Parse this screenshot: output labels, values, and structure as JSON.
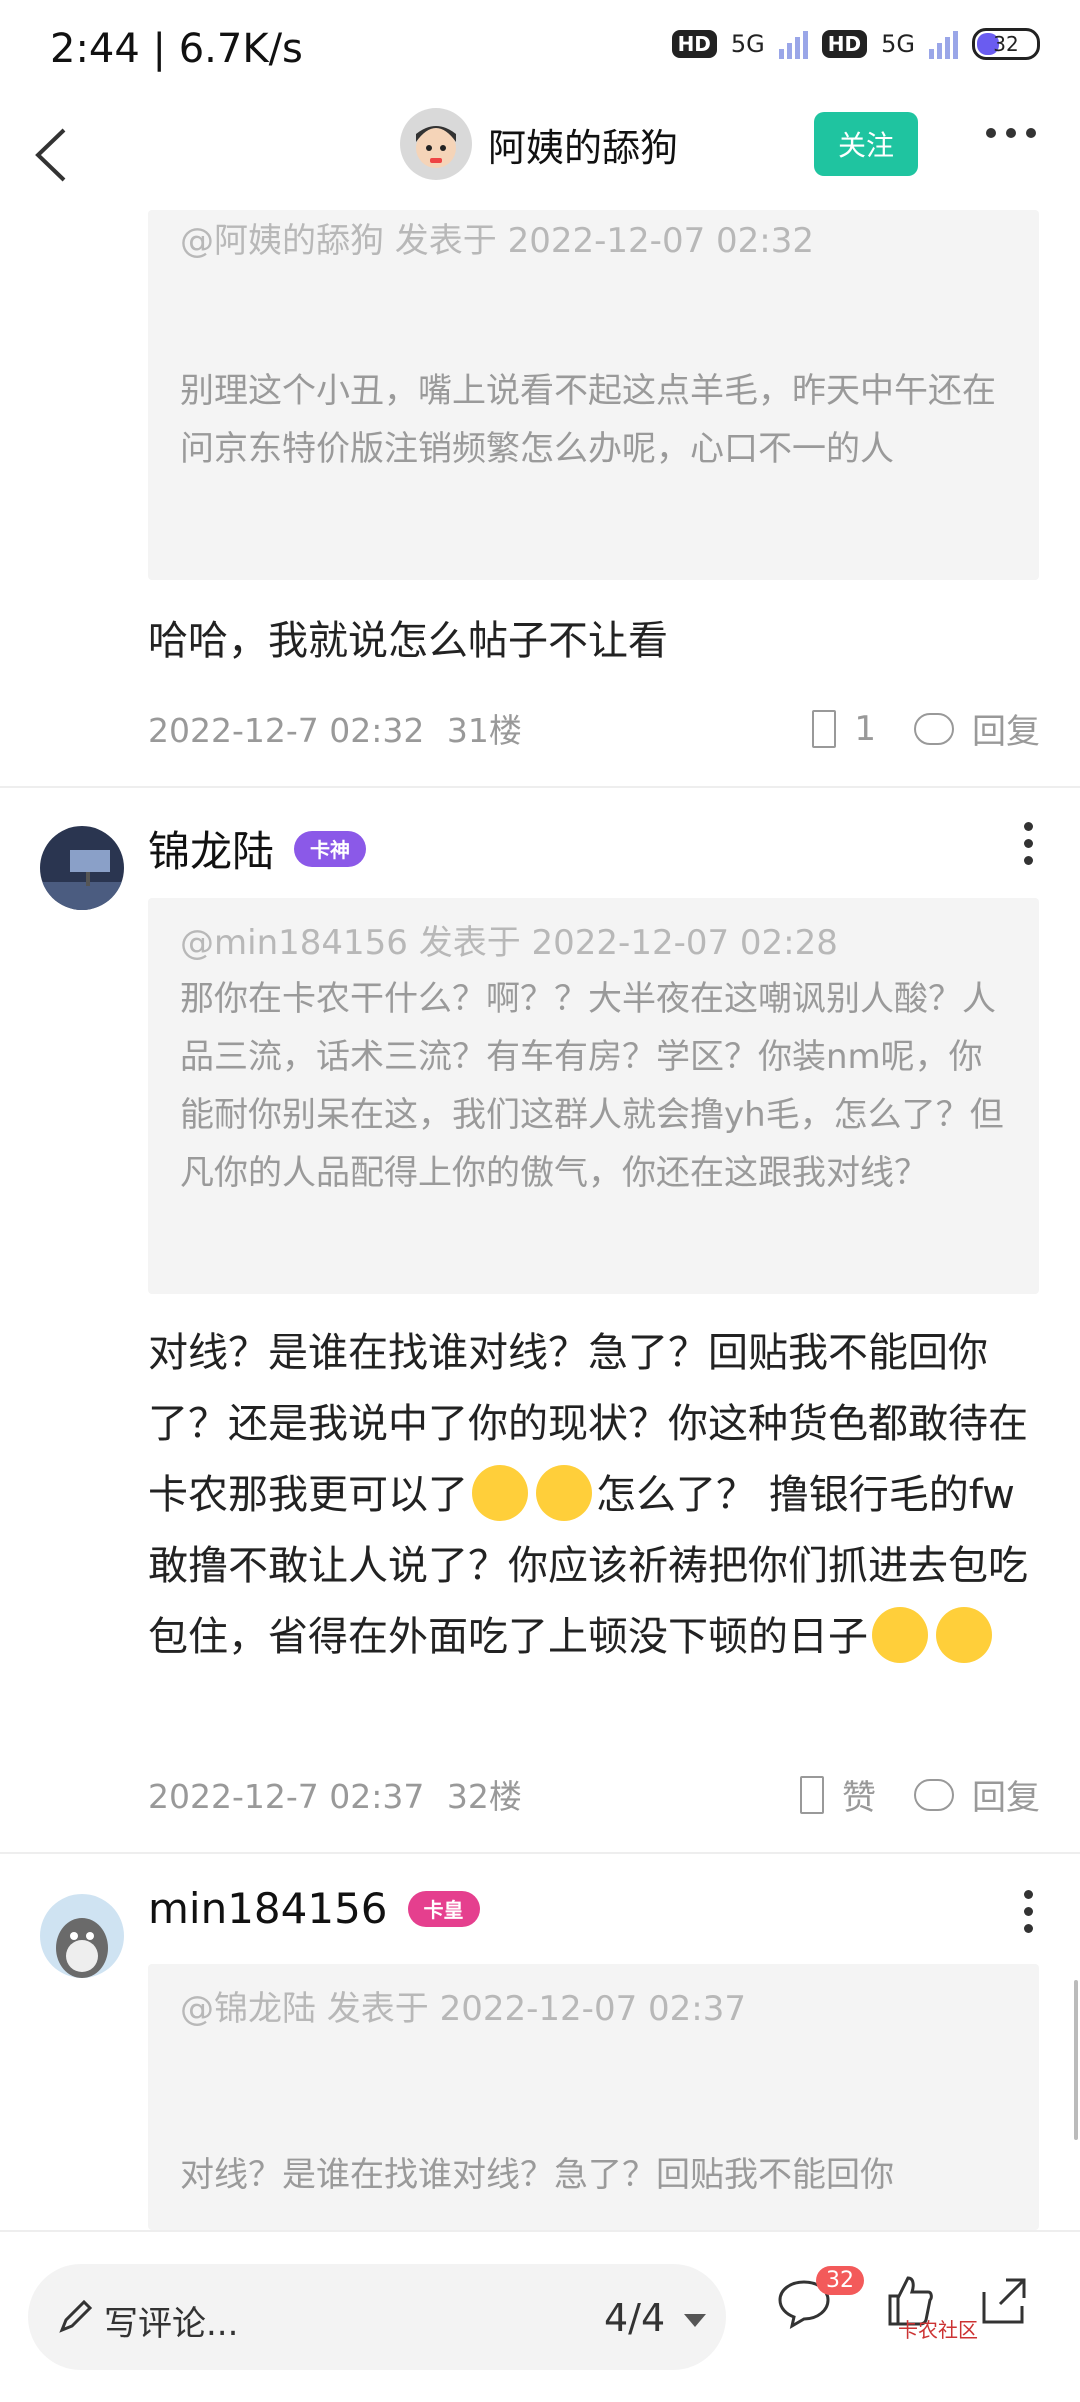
{
  "status_bar": {
    "time": "2:44 | 6.7K/s",
    "network1": "5G",
    "network2": "5G",
    "hd": "HD",
    "battery": "32"
  },
  "nav": {
    "title": "阿姨的舔狗",
    "follow_label": "关注"
  },
  "post1": {
    "quote_header": "@阿姨的舔狗 发表于 2022-12-07 02:32",
    "quote_text": "别理这个小丑，嘴上说看不起这点羊毛，昨天中午还在问京东特价版注销频繁怎么办呢，心口不一的人",
    "body": "哈哈，我就说怎么帖子不让看",
    "date": "2022-12-7 02:32",
    "floor": "31楼",
    "like_count": "1",
    "reply_label": "回复"
  },
  "post2": {
    "username": "锦龙陆",
    "badge": "卡神",
    "quote_header": "@min184156 发表于 2022-12-07 02:28",
    "quote_text": "那你在卡农干什么？啊？？大半夜在这嘲讽别人酸？人品三流，话术三流？有车有房？学区？你装nm呢，你能耐你别呆在这，我们这群人就会撸yh毛，怎么了？但凡你的人品配得上你的傲气，你还在这跟我对线？",
    "body_part1": "对线？是谁在找谁对线？急了？回贴我不能回你了？还是我说中了你的现状？你这种货色都敢待在卡农那我更可以了",
    "body_part2": "怎么了？ 撸银行毛的fw敢撸不敢让人说了？你应该祈祷把你们抓进去包吃包住，省得在外面吃了上顿没下顿的日子",
    "date": "2022-12-7 02:37",
    "floor": "32楼",
    "like_label": "赞",
    "reply_label": "回复"
  },
  "post3": {
    "username": "min184156",
    "badge": "卡皇",
    "quote_header": "@锦龙陆 发表于 2022-12-07 02:37",
    "quote_text": "对线？是谁在找谁对线？急了？回贴我不能回你"
  },
  "bottom_bar": {
    "comment_placeholder": "写评论...",
    "page": "4/4",
    "comment_count": "32",
    "watermark": "卡农社区"
  },
  "colors": {
    "accent": "#1fc4a0",
    "badge_red": "#f35a5a"
  }
}
